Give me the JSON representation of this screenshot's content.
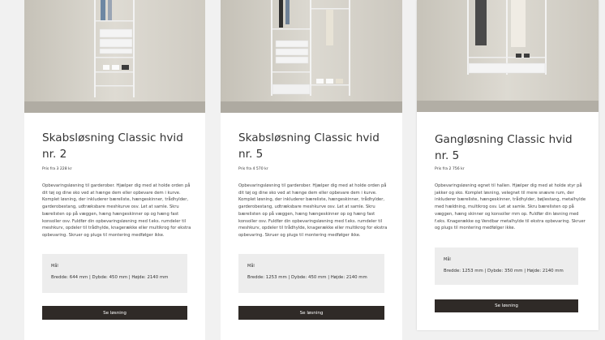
{
  "cards": [
    {
      "title": "Skabsløsning Classic hvid nr. 2",
      "price": "Pris fra 3 228 kr",
      "description": "Opbevaringsløsning til garderober. Hjælper dig med at holde orden på dit tøj og dine sko ved at hænge dem eller opbevare dem i kurve. Komplet løsning, der inkluderer bæreliste, hængeskinner, trådhylder, garderobestang, udtræksbare meshkurve osv. Let at samle. Skru bærelisten op på væggen, hæng hængeskinner op og hæng fast konsoller osv. Fuldfør din opbevaringsløsning med f.eks. rumdeler til meshkurv, opdeler til trådhylde, knagerække eller multikrog for ekstra opbevaring. Skruer og plugs til montering medfølger ikke.",
      "dims_label": "Mål",
      "dims": "Bredde: 644 mm | Dybde: 450 mm | Højde: 2140 mm",
      "button": "Se løsning"
    },
    {
      "title": "Skabsløsning Classic hvid nr. 5",
      "price": "Pris fra 4 570 kr",
      "description": "Opbevaringsløsning til garderober. Hjælper dig med at holde orden på dit tøj og dine sko ved at hænge dem eller opbevare dem i kurve. Komplet løsning, der inkluderer bæreliste, hængeskinner, trådhylder, garderobestang, udtræksbare meshkurve osv. Let at samle. Skru bærelisten op på væggen, hæng hængeskinner op og hæng fast konsoller osv. Fuldfør din opbevaringsløsning med f.eks. rumdeler til meshkurv, opdeler til trådhylde, knagerække eller multikrog for ekstra opbevaring. Skruer og plugs til montering medfølger ikke.",
      "dims_label": "Mål",
      "dims": "Bredde: 1253 mm | Dybde: 450 mm | Højde: 2140 mm",
      "button": "Se løsning"
    },
    {
      "title": "Gangløsning Classic hvid nr. 5",
      "price": "Pris fra 2 756 kr",
      "description": "Opbevaringsløsning egnet til hallen. Hjælper dig med at holde styr på jakker og sko. Komplet løsning, velegnet til mere snævre rum, der inkluderer bæreliste, hængeskinner, trådhylder, bøjlestang, metalhylde med hældning, multikrog osv. Let at samle. Skru bærelisten op på væggen, hæng skinner og konsoller mm op. Fuldfør din løsning med f.eks. Knagerække og Vendbar metalhylde til ekstra opbevaring. Skruer og plugs til montering medfølger ikke.",
      "dims_label": "Mål",
      "dims": "Bredde: 1253 mm | Dybde: 350 mm | Højde: 2140 mm",
      "button": "Se løsning"
    }
  ]
}
